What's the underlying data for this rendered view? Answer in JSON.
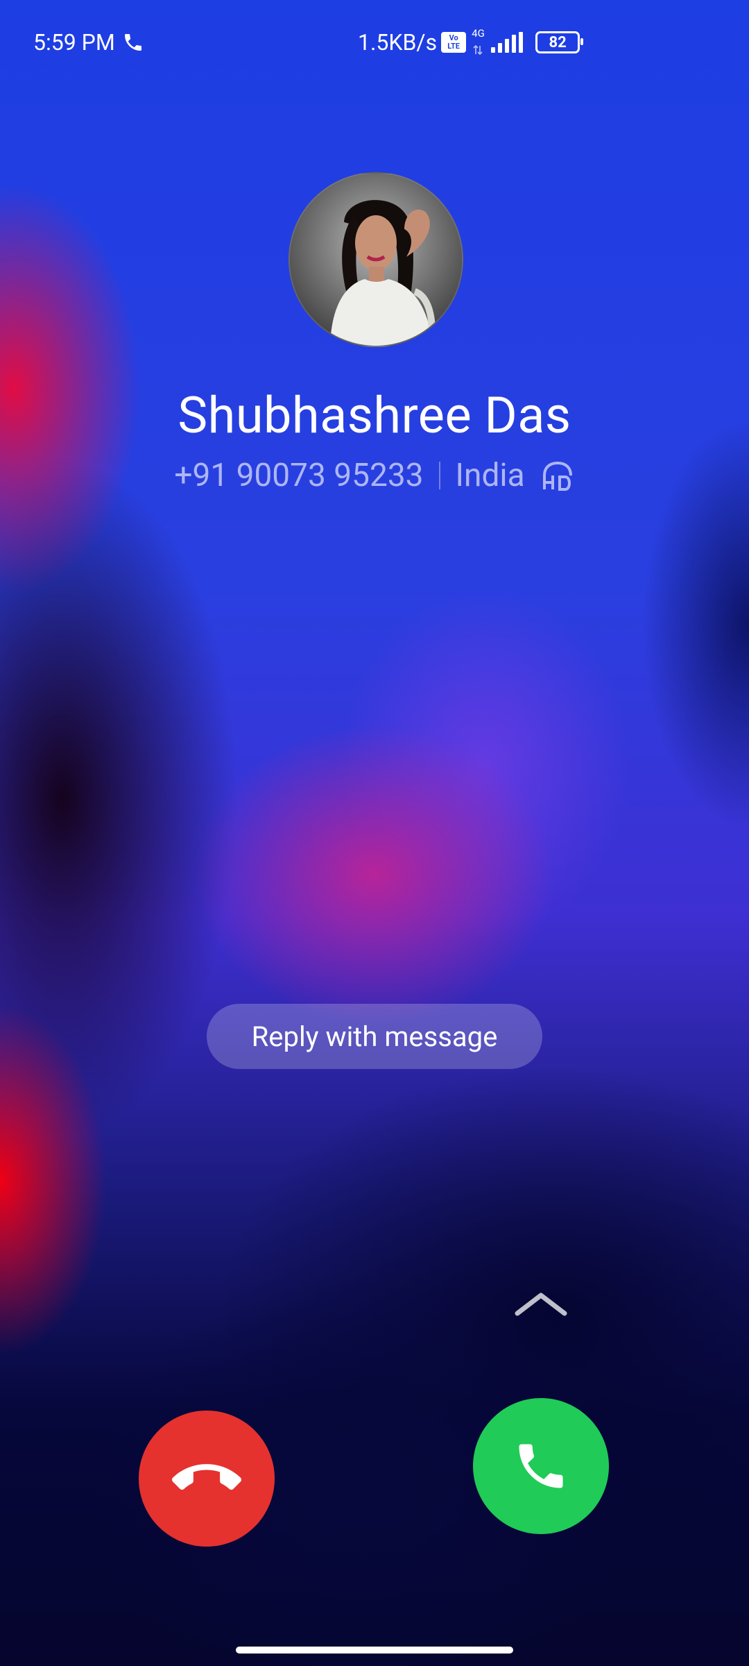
{
  "status_bar": {
    "time": "5:59 PM",
    "network_speed": "1.5KB/s",
    "volte_top": "Vo",
    "volte_bottom": "LTE",
    "network_type": "4G",
    "battery": "82"
  },
  "caller": {
    "name": "Shubhashree Das",
    "number": "+91 90073 95233",
    "location": "India"
  },
  "actions": {
    "reply_label": "Reply with message"
  },
  "colors": {
    "decline": "#e5322f",
    "answer": "#20cb57"
  },
  "icons": {
    "call_indicator": "phone-icon",
    "hd": "hd-voice-icon",
    "swipe": "chevron-up-icon",
    "decline": "end-call-icon",
    "answer": "phone-icon"
  }
}
